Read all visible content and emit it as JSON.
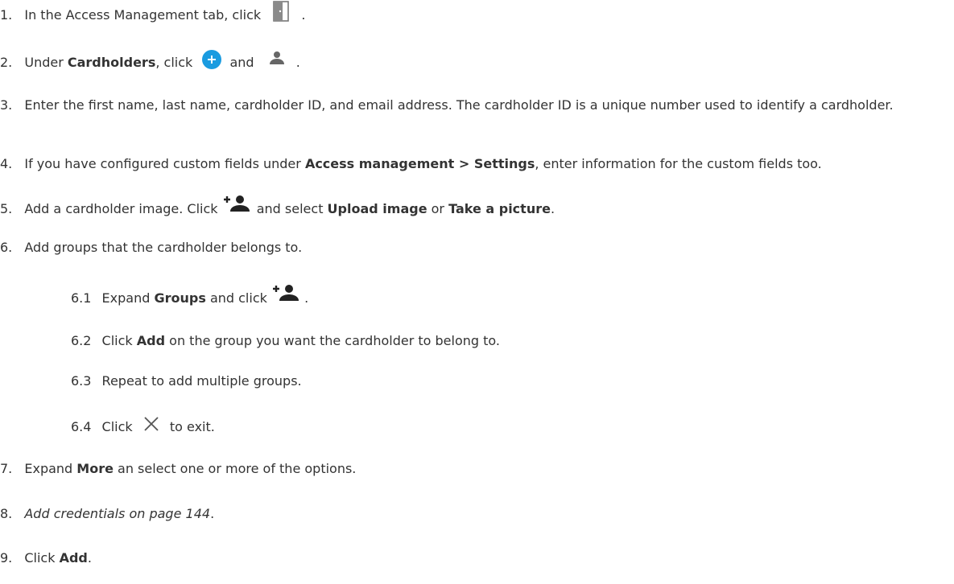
{
  "steps": [
    {
      "num": "1.",
      "pre": "In the Access Management tab, click",
      "post": "."
    },
    {
      "num": "2.",
      "pre": "Under ",
      "bold": "Cardholders",
      "mid": ", click",
      "and": "and",
      "post": "."
    },
    {
      "num": "3.",
      "text": "Enter the first name, last name, cardholder ID, and email address. The cardholder ID is a unique number used to identify a cardholder."
    },
    {
      "num": "4.",
      "pre": "If you have configured custom fields under ",
      "bold": "Access management > Settings",
      "post": ", enter information for the custom fields too."
    },
    {
      "num": "5.",
      "pre": "Add a cardholder image. Click",
      "mid": "and select ",
      "bold1": "Upload image",
      "or": " or ",
      "bold2": "Take a picture",
      "post": "."
    },
    {
      "num": "6.",
      "text": "Add groups that the cardholder belongs to."
    },
    {
      "num": "7.",
      "pre": "Expand ",
      "bold": "More",
      "post": " an select one or more of the options."
    },
    {
      "num": "8.",
      "italic": "Add credentials on page 144",
      "post": "."
    },
    {
      "num": "9.",
      "pre": "Click ",
      "bold": "Add",
      "post": "."
    }
  ],
  "substeps": [
    {
      "num": "6.1",
      "pre": "Expand ",
      "bold": "Groups",
      "mid": " and click",
      "post": "."
    },
    {
      "num": "6.2",
      "pre": "Click ",
      "bold": "Add",
      "post": " on the group you want the cardholder to belong to."
    },
    {
      "num": "6.3",
      "text": "Repeat to add multiple groups."
    },
    {
      "num": "6.4",
      "pre": "Click",
      "post": "to exit."
    }
  ],
  "colors": {
    "text": "#333333",
    "icon_gray": "#666666",
    "plus_blue": "#1a9be0"
  },
  "icons": [
    "door-icon",
    "add-circle-icon",
    "person-icon",
    "add-person-icon",
    "close-icon"
  ]
}
